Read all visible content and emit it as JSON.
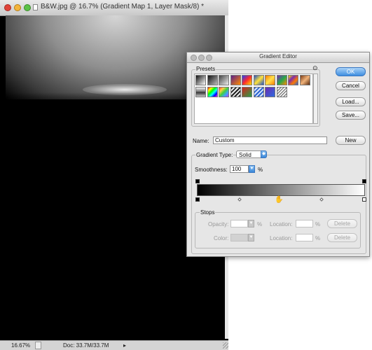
{
  "document_window": {
    "title": "B&W.jpg @ 16.7% (Gradient Map 1, Layer Mask/8) *",
    "status": {
      "zoom": "16.67%",
      "doc_size": "Doc: 33.7M/33.7M",
      "arrow": "▸"
    }
  },
  "gradient_editor": {
    "title": "Gradient Editor",
    "presets": {
      "label": "Presets",
      "menu_glyph": "⊙",
      "swatches": [
        {
          "name": "black-white",
          "fill": "linear-gradient(135deg,#111,#fff)"
        },
        {
          "name": "black-transparent",
          "fill": "linear-gradient(135deg,#111,#bbb)"
        },
        {
          "name": "foreground-background",
          "fill": "linear-gradient(135deg,#444,#eee)"
        },
        {
          "name": "violet-orange",
          "fill": "linear-gradient(135deg,#5b1f8a,#ff8a00)"
        },
        {
          "name": "blue-red-yellow",
          "fill": "linear-gradient(135deg,#1e3cff,#ff2a2a,#ffe600)"
        },
        {
          "name": "blue-yellow-blue",
          "fill": "linear-gradient(135deg,#2051c9,#ffe23a,#2051c9)"
        },
        {
          "name": "orange-yellow-orange",
          "fill": "linear-gradient(135deg,#ff7a00,#ffe14a,#ff7a00)"
        },
        {
          "name": "violet-green-orange",
          "fill": "linear-gradient(135deg,#7a2bb0,#24a84a,#ff8a00)"
        },
        {
          "name": "yellow-violet-orange-blue",
          "fill": "linear-gradient(135deg,#ffe100,#7b2bb0,#ff7a00,#2060e0)"
        },
        {
          "name": "copper",
          "fill": "linear-gradient(135deg,#7a3b16,#f0b37a,#5a2a0e)"
        },
        {
          "name": "chrome",
          "fill": "linear-gradient(180deg,#f4f4f4,#6d6d6d 48%,#2f2f2f 52%,#c8c8c8)"
        },
        {
          "name": "spectrum",
          "fill": "linear-gradient(135deg,#ff0000,#ffff00,#00ff00,#00ffff,#0000ff,#ff00ff)"
        },
        {
          "name": "transparent-rainbow",
          "fill": "linear-gradient(135deg,#ff4040,#ffd040,#40d040,#40a0ff,#c040ff)"
        },
        {
          "name": "transparent-stripes",
          "fill": "repeating-linear-gradient(135deg,#222 0 2px,#eee 2px 4px)"
        },
        {
          "name": "red-green",
          "fill": "linear-gradient(135deg,#d61f1f,#23a347)"
        },
        {
          "name": "blue-stripes",
          "fill": "repeating-linear-gradient(135deg,#2e63cf 0 2px,#d6e6ff 2px 4px)"
        },
        {
          "name": "violet-blue",
          "fill": "linear-gradient(135deg,#6b2bb0,#2f6be0)"
        },
        {
          "name": "silver-stripes",
          "fill": "repeating-linear-gradient(135deg,#666 0 1px,#f2f2f2 1px 3px)"
        }
      ]
    },
    "buttons": {
      "ok": "OK",
      "cancel": "Cancel",
      "load": "Load...",
      "save": "Save...",
      "new": "New",
      "delete": "Delete"
    },
    "name_label": "Name:",
    "name_value": "Custom",
    "gradient_type": {
      "label": "Gradient Type:",
      "value": "Solid"
    },
    "smoothness": {
      "label": "Smoothness:",
      "value": "100",
      "unit": "%"
    },
    "gradient_bar": {
      "fill": "linear-gradient(to right,#000 0%,#777 45%,#ffffff 100%)"
    },
    "stops": {
      "label": "Stops",
      "opacity_label": "Opacity:",
      "color_label": "Color:",
      "location_label": "Location:",
      "percent": "%"
    }
  },
  "colors": {
    "primary_button": "#3f8fe0",
    "dialog_bg": "#e6e6e6"
  }
}
